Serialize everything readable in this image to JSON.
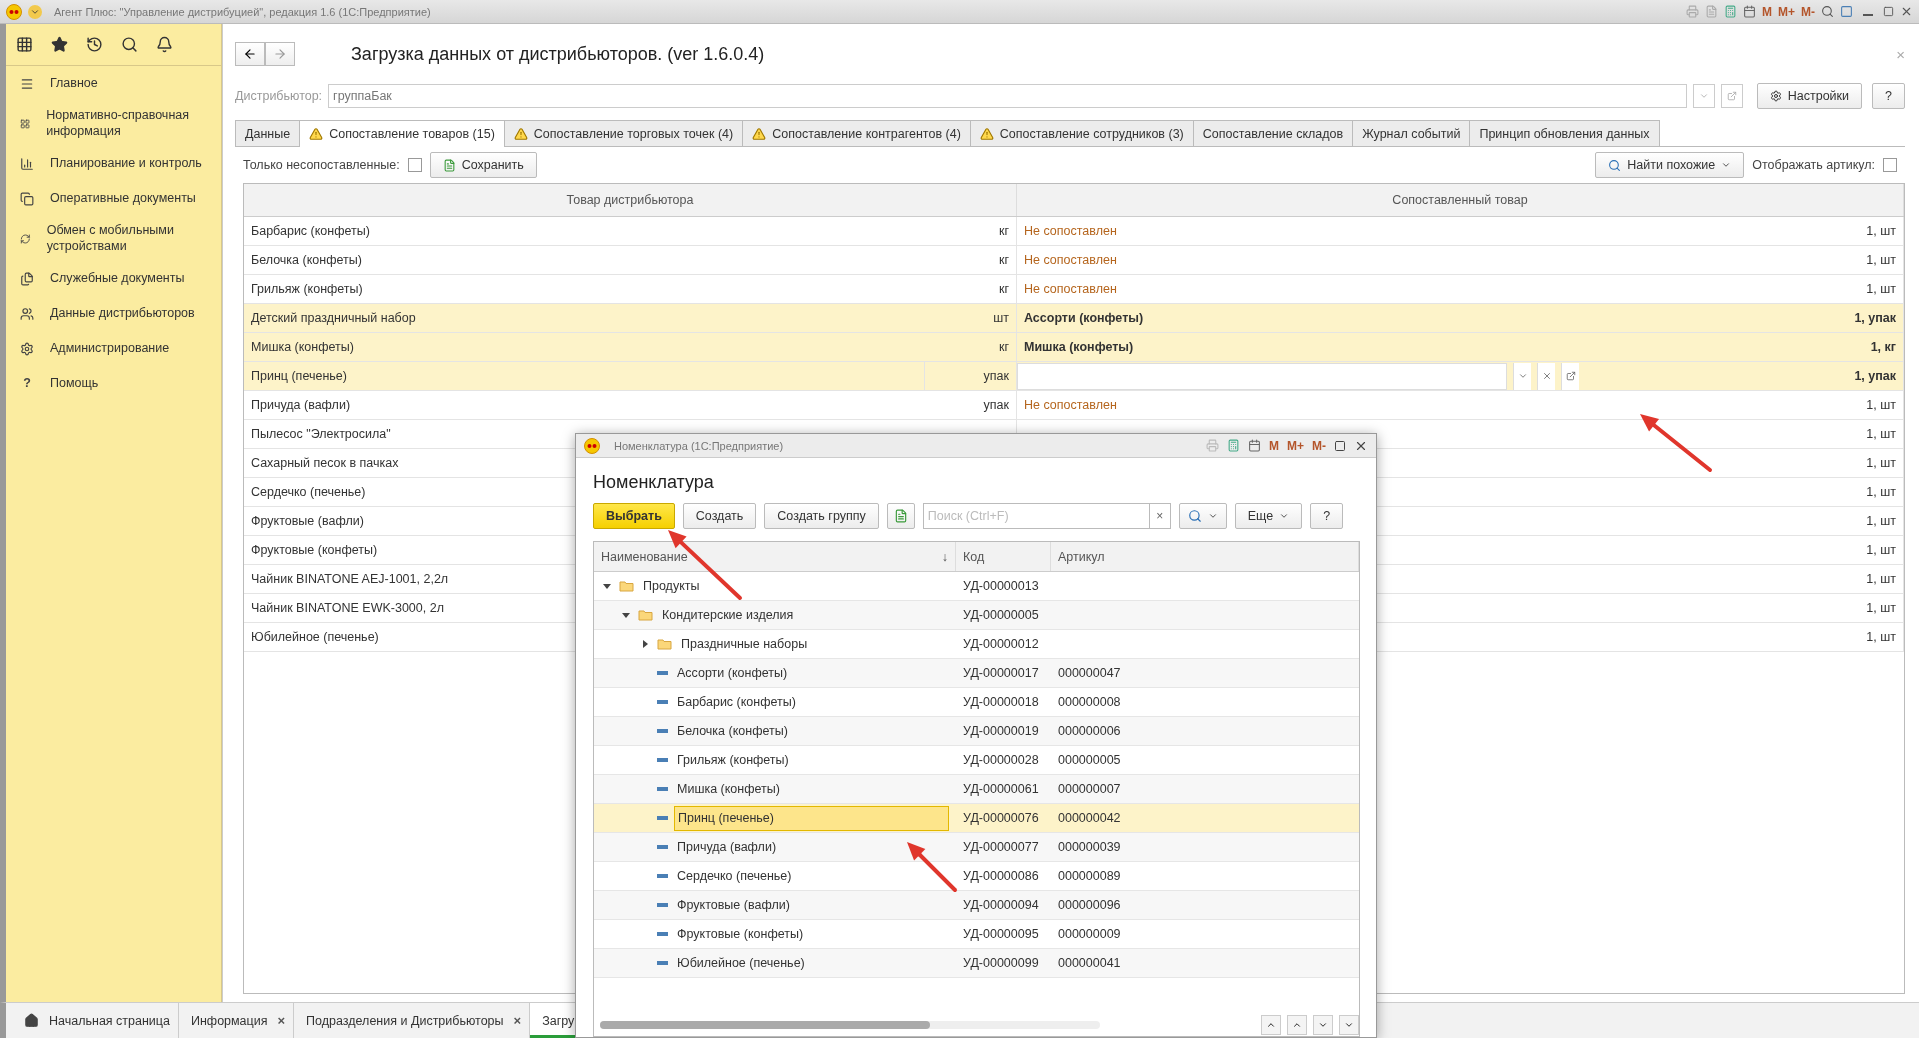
{
  "window": {
    "title": "Агент Плюс: \"Управление дистрибуцией\", редакция 1.6  (1С:Предприятие)",
    "memory_buttons": [
      "M",
      "M+",
      "M-"
    ]
  },
  "sidebar": {
    "items": [
      "Главное",
      "Нормативно-справочная информация",
      "Планирование и контроль",
      "Оперативные документы",
      "Обмен с мобильными устройствами",
      "Служебные документы",
      "Данные дистрибьюторов",
      "Администрирование",
      "Помощь"
    ],
    "help_mark": "?"
  },
  "form": {
    "title": "Загрузка данных от дистрибьюторов. (ver 1.6.0.4)",
    "close": "×",
    "distributor_label": "Дистрибьютор:",
    "distributor_value": "группаБак",
    "settings_button": "Настройки",
    "help_button": "?",
    "tabs": [
      {
        "label": "Данные",
        "warning": false,
        "selected": false
      },
      {
        "label": "Сопоставление товаров (15)",
        "warning": true,
        "selected": true
      },
      {
        "label": "Сопоставление торговых точек (4)",
        "warning": true,
        "selected": false
      },
      {
        "label": "Сопоставление контрагентов (4)",
        "warning": true,
        "selected": false
      },
      {
        "label": "Сопоставление сотрудников (3)",
        "warning": true,
        "selected": false
      },
      {
        "label": "Сопоставление складов",
        "warning": false,
        "selected": false
      },
      {
        "label": "Журнал событий",
        "warning": false,
        "selected": false
      },
      {
        "label": "Принцип обновления данных",
        "warning": false,
        "selected": false
      }
    ],
    "only_unmatched_label": "Только несопоставленные:",
    "only_unmatched": false,
    "save_button": "Сохранить",
    "find_button": "Найти похожие",
    "show_article_label": "Отображать артикул:",
    "show_article": false,
    "columns": [
      "Товар дистрибьютора",
      "Сопоставленный товар"
    ],
    "rows": [
      {
        "name": "Барбарис (конфеты)",
        "unit": "кг",
        "match": "Не сопоставлен",
        "qty": "1, шт",
        "highlighted": false,
        "editing": false
      },
      {
        "name": "Белочка (конфеты)",
        "unit": "кг",
        "match": "Не сопоставлен",
        "qty": "1, шт",
        "highlighted": false,
        "editing": false
      },
      {
        "name": "Грильяж (конфеты)",
        "unit": "кг",
        "match": "Не сопоставлен",
        "qty": "1, шт",
        "highlighted": false,
        "editing": false
      },
      {
        "name": "Детский праздничный набор",
        "unit": "шт",
        "match": "Ассорти (конфеты)",
        "qty": "1, упак",
        "highlighted": true,
        "editing": false
      },
      {
        "name": "Мишка (конфеты)",
        "unit": "кг",
        "match": "Мишка (конфеты)",
        "qty": "1, кг",
        "highlighted": true,
        "editing": false
      },
      {
        "name": "Принц (печенье)",
        "unit": "упак",
        "qty": "1, упак",
        "highlighted": true,
        "editing": true
      },
      {
        "name": "Причуда (вафли)",
        "unit": "упак",
        "match": "Не сопоставлен",
        "qty": "1, шт",
        "highlighted": false,
        "editing": false
      },
      {
        "name": "Пылесос \"Электросила\"",
        "qty": "1, шт",
        "highlighted": false,
        "editing": false
      },
      {
        "name": "Сахарный песок в пачках",
        "qty": "1, шт",
        "highlighted": false,
        "editing": false
      },
      {
        "name": "Сердечко (печенье)",
        "qty": "1, шт",
        "highlighted": false,
        "editing": false
      },
      {
        "name": "Фруктовые (вафли)",
        "qty": "1, шт",
        "highlighted": false,
        "editing": false
      },
      {
        "name": "Фруктовые (конфеты)",
        "qty": "1, шт",
        "highlighted": false,
        "editing": false
      },
      {
        "name": "Чайник BINATONE  AEJ-1001,  2,2л",
        "qty": "1, шт",
        "highlighted": false,
        "editing": false
      },
      {
        "name": "Чайник BINATONE  EWK-3000,  2л",
        "qty": "1, шт",
        "highlighted": false,
        "editing": false
      },
      {
        "name": "Юбилейное (печенье)",
        "qty": "1, шт",
        "highlighted": false,
        "editing": false
      }
    ]
  },
  "taskbar": [
    {
      "label": "Начальная страница",
      "kind": "home",
      "selected": false
    },
    {
      "label": "Информация",
      "kind": "page",
      "close": "×",
      "selected": false
    },
    {
      "label": "Подразделения и Дистрибьюторы",
      "kind": "page",
      "close": "×",
      "selected": false
    },
    {
      "label": "Загру",
      "kind": "page",
      "selected": true
    }
  ],
  "dialog": {
    "title": "Номенклатура  (1С:Предприятие)",
    "memory_buttons": [
      "M",
      "M+",
      "M-"
    ],
    "heading": "Номенклатура",
    "select_button": "Выбрать",
    "create_button": "Создать",
    "create_group_button": "Создать группу",
    "search_placeholder": "Поиск (Ctrl+F)",
    "clear": "×",
    "more_button": "Еще",
    "help_button": "?",
    "columns": [
      "Наименование",
      "Код",
      "Артикул"
    ],
    "sort_mark": "↓",
    "tree": [
      {
        "name": "Продукты",
        "code": "УД-00000013",
        "kind": "folder",
        "expanded": true,
        "selected": false,
        "children": [
          {
            "name": "Кондитерские изделия",
            "code": "УД-00000005",
            "kind": "folder",
            "expanded": true,
            "selected": false,
            "children": [
              {
                "name": "Праздничные наборы",
                "code": "УД-00000012",
                "kind": "folder",
                "expanded": false,
                "selected": false
              },
              {
                "name": "Ассорти (конфеты)",
                "code": "УД-00000017",
                "article": "000000047",
                "kind": "item",
                "selected": false
              },
              {
                "name": "Барбарис (конфеты)",
                "code": "УД-00000018",
                "article": "000000008",
                "kind": "item",
                "selected": false
              },
              {
                "name": "Белочка (конфеты)",
                "code": "УД-00000019",
                "article": "000000006",
                "kind": "item",
                "selected": false
              },
              {
                "name": "Грильяж (конфеты)",
                "code": "УД-00000028",
                "article": "000000005",
                "kind": "item",
                "selected": false
              },
              {
                "name": "Мишка (конфеты)",
                "code": "УД-00000061",
                "article": "000000007",
                "kind": "item",
                "selected": false
              },
              {
                "name": "Принц (печенье)",
                "code": "УД-00000076",
                "article": "000000042",
                "kind": "item",
                "selected": true
              },
              {
                "name": "Причуда (вафли)",
                "code": "УД-00000077",
                "article": "000000039",
                "kind": "item",
                "selected": false
              },
              {
                "name": "Сердечко (печенье)",
                "code": "УД-00000086",
                "article": "000000089",
                "kind": "item",
                "selected": false
              },
              {
                "name": "Фруктовые (вафли)",
                "code": "УД-00000094",
                "article": "000000096",
                "kind": "item",
                "selected": false
              },
              {
                "name": "Фруктовые (конфеты)",
                "code": "УД-00000095",
                "article": "000000009",
                "kind": "item",
                "selected": false
              },
              {
                "name": "Юбилейное (печенье)",
                "code": "УД-00000099",
                "article": "000000041",
                "kind": "item",
                "selected": false
              }
            ]
          }
        ]
      }
    ]
  }
}
